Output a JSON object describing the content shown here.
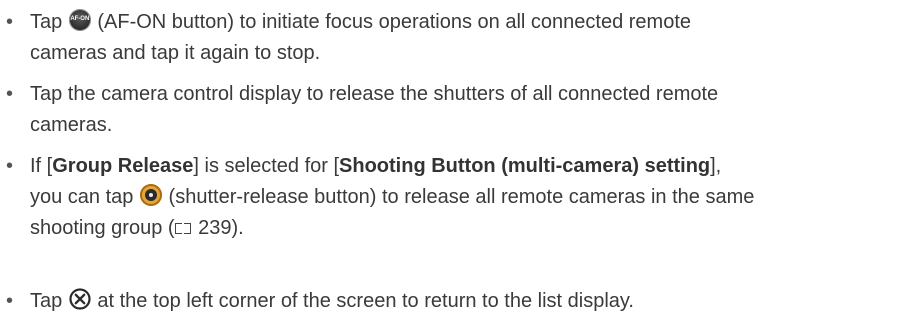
{
  "bullet": "•",
  "icons": {
    "af_on": "AF-ON",
    "shutter": "shutter-release-icon",
    "close": "close-circle-icon",
    "page_ref": "book-icon"
  },
  "items": [
    {
      "line1_pre": "Tap",
      "line1_post": "(AF-ON button) to initiate focus operations on all connected remote",
      "line2": "cameras and tap it again to stop."
    },
    {
      "line1": "Tap the camera control display to release the shutters of all connected remote",
      "line2": "cameras."
    },
    {
      "line1_a": "If [",
      "line1_b": "Group Release",
      "line1_c": "] is selected for [",
      "line1_d": "Shooting Button (multi-camera) setting",
      "line1_e": "],",
      "line2_pre": "you can tap",
      "line2_post": "(shutter-release button) to release all remote cameras in the same",
      "line3_pre": "shooting group (",
      "line3_page": "239",
      "line3_post": ")."
    },
    {
      "line1_pre": "Tap",
      "line1_post": "at the top left corner of the screen to return to the list display."
    }
  ]
}
